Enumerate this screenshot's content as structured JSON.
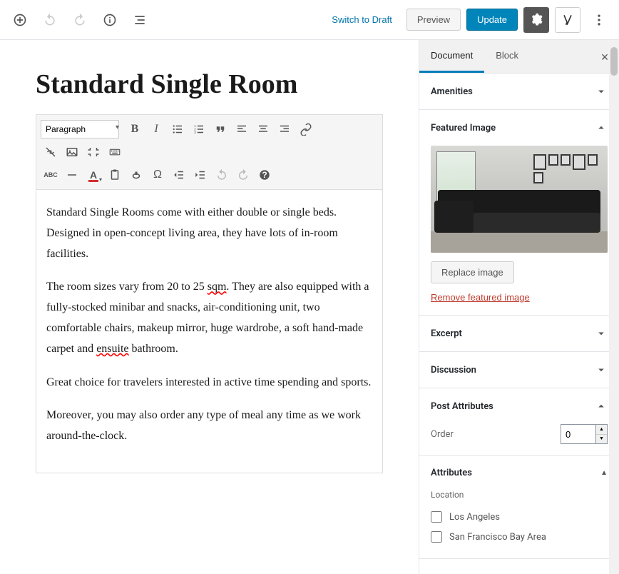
{
  "topbar": {
    "switch_draft": "Switch to Draft",
    "preview": "Preview",
    "update": "Update"
  },
  "post": {
    "title": "Standard Single Room",
    "format_selector": "Paragraph",
    "paragraphs": [
      "Standard Single Rooms come with either double or single beds. Designed in open-concept living area, they have lots of in-room facilities.",
      "The room sizes vary from 20 to 25 sqm. They are also equipped with a fully-stocked minibar and snacks, air-conditioning unit, two comfortable chairs, makeup mirror, huge wardrobe, a soft hand-made carpet and ensuite bathroom.",
      "Great choice for travelers interested in active time spending and sports.",
      "Moreover, you may also order any type of meal any time as we work around-the-clock."
    ]
  },
  "sidebar": {
    "tabs": {
      "document": "Document",
      "block": "Block"
    },
    "panels": {
      "amenities": "Amenities",
      "featured_image": "Featured Image",
      "replace_image": "Replace image",
      "remove_image": "Remove featured image",
      "excerpt": "Excerpt",
      "discussion": "Discussion",
      "post_attributes": "Post Attributes",
      "order_label": "Order",
      "order_value": "0",
      "attributes": "Attributes",
      "location_label": "Location",
      "locations": [
        "Los Angeles",
        "San Francisco Bay Area"
      ]
    }
  }
}
